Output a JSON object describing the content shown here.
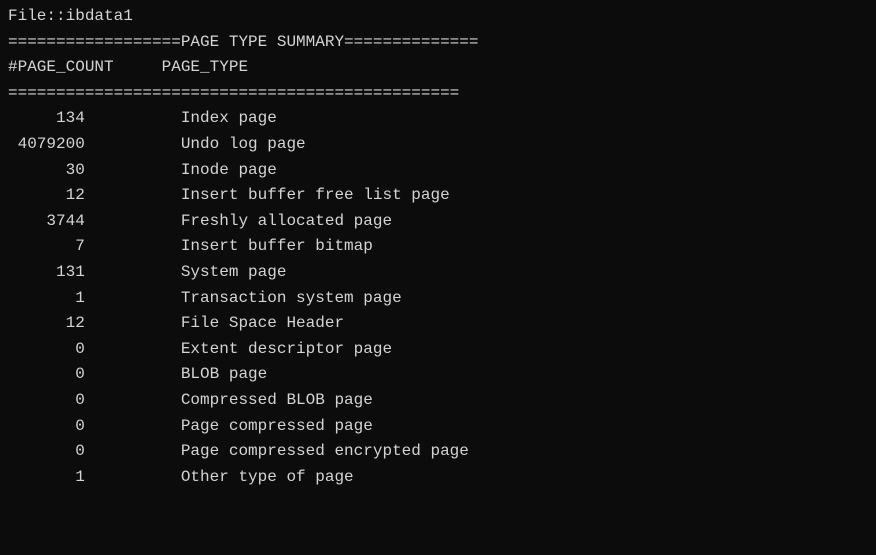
{
  "file_label": "File::",
  "file_name": "ibdata1",
  "section_header": "==================PAGE TYPE SUMMARY==============",
  "column_headers": {
    "count": "#PAGE_COUNT",
    "type": "PAGE_TYPE"
  },
  "divider": "===============================================",
  "rows": [
    {
      "count": "134",
      "type": "Index page"
    },
    {
      "count": "4079200",
      "type": "Undo log page"
    },
    {
      "count": "30",
      "type": "Inode page"
    },
    {
      "count": "12",
      "type": "Insert buffer free list page"
    },
    {
      "count": "3744",
      "type": "Freshly allocated page"
    },
    {
      "count": "7",
      "type": "Insert buffer bitmap"
    },
    {
      "count": "131",
      "type": "System page"
    },
    {
      "count": "1",
      "type": "Transaction system page"
    },
    {
      "count": "12",
      "type": "File Space Header"
    },
    {
      "count": "0",
      "type": "Extent descriptor page"
    },
    {
      "count": "0",
      "type": "BLOB page"
    },
    {
      "count": "0",
      "type": "Compressed BLOB page"
    },
    {
      "count": "0",
      "type": "Page compressed page"
    },
    {
      "count": "0",
      "type": "Page compressed encrypted page"
    },
    {
      "count": "1",
      "type": "Other type of page"
    }
  ]
}
